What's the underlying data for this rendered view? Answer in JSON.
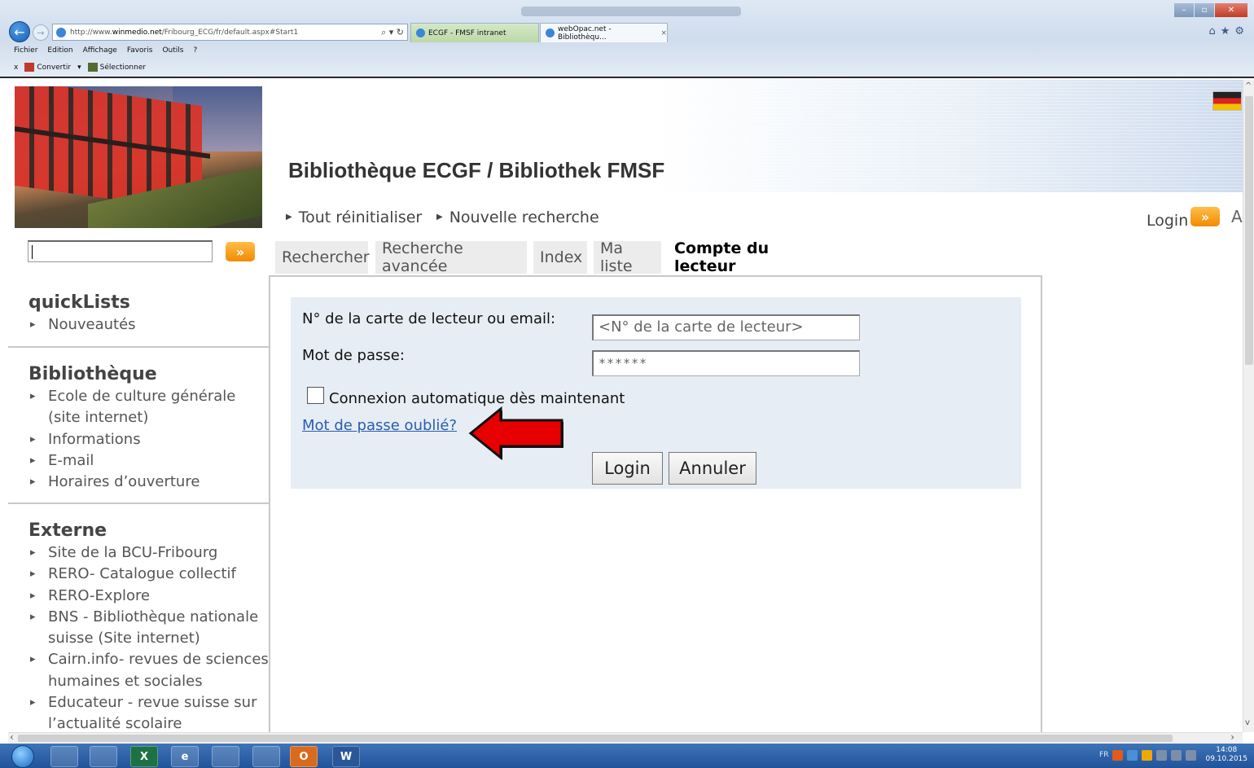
{
  "browser": {
    "address": {
      "prefix": "http://www.",
      "host": "winmedio.net",
      "path": "/Fribourg_ECG/fr/default.aspx#Start1",
      "tools": "⌕ ▾ ↻"
    },
    "tabs": [
      {
        "label": "ECGF - FMSF intranet"
      },
      {
        "label": "webOpac.net - Bibliothèqu...",
        "close": "×"
      }
    ],
    "menu": [
      "Fichier",
      "Edition",
      "Affichage",
      "Favoris",
      "Outils",
      "?"
    ],
    "command_bar": {
      "close": "x",
      "convert": "Convertir",
      "convert_arrow": "▾",
      "select": "Sélectionner"
    },
    "window_controls": {
      "minimize": "–",
      "maximize": "▫",
      "close": "✕"
    },
    "fav_icons": "⌂★⚙"
  },
  "page": {
    "title": "Bibliothèque ECGF / Bibliothek FMSF",
    "search_button": "»",
    "top_nav": {
      "reset": "Tout réinitialiser",
      "new_search": "Nouvelle recherche",
      "login": "Login",
      "login_button": "»",
      "font_size": "A"
    },
    "tabs": [
      {
        "label": "Rechercher"
      },
      {
        "label": "Recherche avancée"
      },
      {
        "label": "Index"
      },
      {
        "label": "Ma liste"
      },
      {
        "label": "Compte du lecteur",
        "active": true
      }
    ],
    "form": {
      "card_label": "N° de la carte de lecteur ou email:",
      "card_placeholder": "<N° de la carte de lecteur>",
      "password_label": "Mot de passe:",
      "password_value": "******",
      "auto_login_label": "Connexion automatique dès maintenant",
      "auto_login_checked": false,
      "forgot_password": "Mot de passe oublié?",
      "login_button": "Login",
      "cancel_button": "Annuler"
    },
    "sidebar": {
      "quicklists": {
        "heading": "quickLists",
        "items": [
          "Nouveautés"
        ]
      },
      "bibliotheque": {
        "heading": "Bibliothèque",
        "items": [
          "Ecole de culture générale (site internet)",
          "Informations",
          "E-mail",
          "Horaires d’ouverture"
        ]
      },
      "externe": {
        "heading": "Externe",
        "items": [
          "Site de la BCU-Fribourg",
          "RERO- Catalogue collectif",
          "RERO-Explore",
          "BNS - Bibliothèque nationale suisse (Site internet)",
          "Cairn.info- revues de sciences humaines et sociales",
          "Educateur - revue suisse sur l’actualité scolaire"
        ]
      }
    }
  },
  "taskbar": {
    "apps": [
      "",
      "",
      "X",
      "e",
      "",
      "",
      "O",
      "W"
    ],
    "tray": {
      "lang": "FR",
      "time": "14:08",
      "date": "09.10.2015"
    }
  },
  "colors": {
    "accent_orange": "#f18a00",
    "link_blue": "#2a5db0",
    "form_bg": "#e6edf4",
    "arrow_red": "#e60000"
  }
}
